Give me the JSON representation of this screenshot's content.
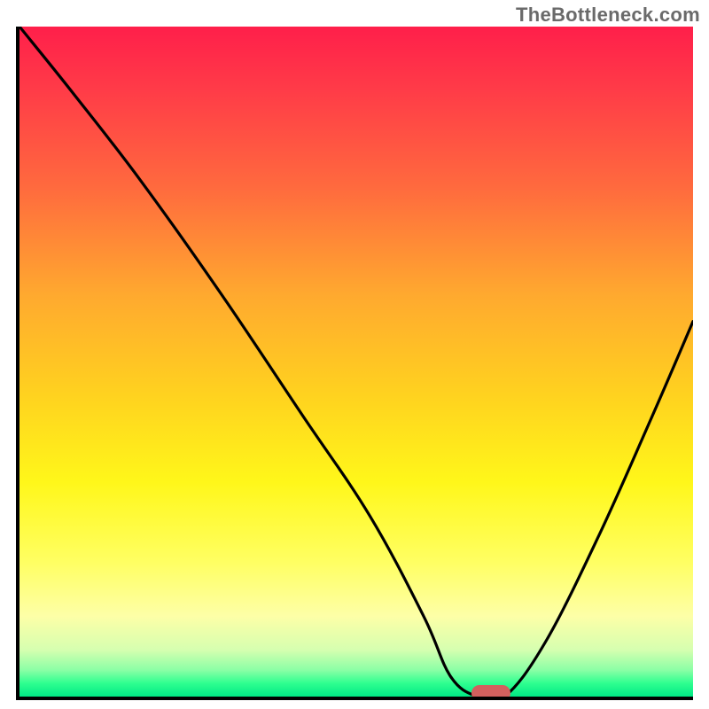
{
  "watermark": "TheBottleneck.com",
  "chart_data": {
    "type": "line",
    "title": "",
    "xlabel": "",
    "ylabel": "",
    "xlim": [
      0,
      100
    ],
    "ylim": [
      0,
      100
    ],
    "grid": false,
    "legend": false,
    "series": [
      {
        "name": "bottleneck-curve",
        "x": [
          0,
          8,
          18,
          30,
          42,
          52,
          60,
          64,
          68,
          72,
          78,
          86,
          94,
          100
        ],
        "y": [
          100,
          90,
          77,
          60,
          42,
          27,
          12,
          3,
          0,
          0,
          8,
          24,
          42,
          56
        ]
      }
    ],
    "annotations": [
      {
        "name": "optimal-marker",
        "x": 70,
        "y": 0,
        "shape": "pill",
        "color": "#d2605e"
      }
    ],
    "background_gradient": {
      "direction": "vertical",
      "stops": [
        {
          "pos": 0.0,
          "color": "#ff1f4a"
        },
        {
          "pos": 0.4,
          "color": "#ffa92f"
        },
        {
          "pos": 0.68,
          "color": "#fff71a"
        },
        {
          "pos": 0.93,
          "color": "#d6ffb0"
        },
        {
          "pos": 1.0,
          "color": "#00e884"
        }
      ]
    }
  }
}
